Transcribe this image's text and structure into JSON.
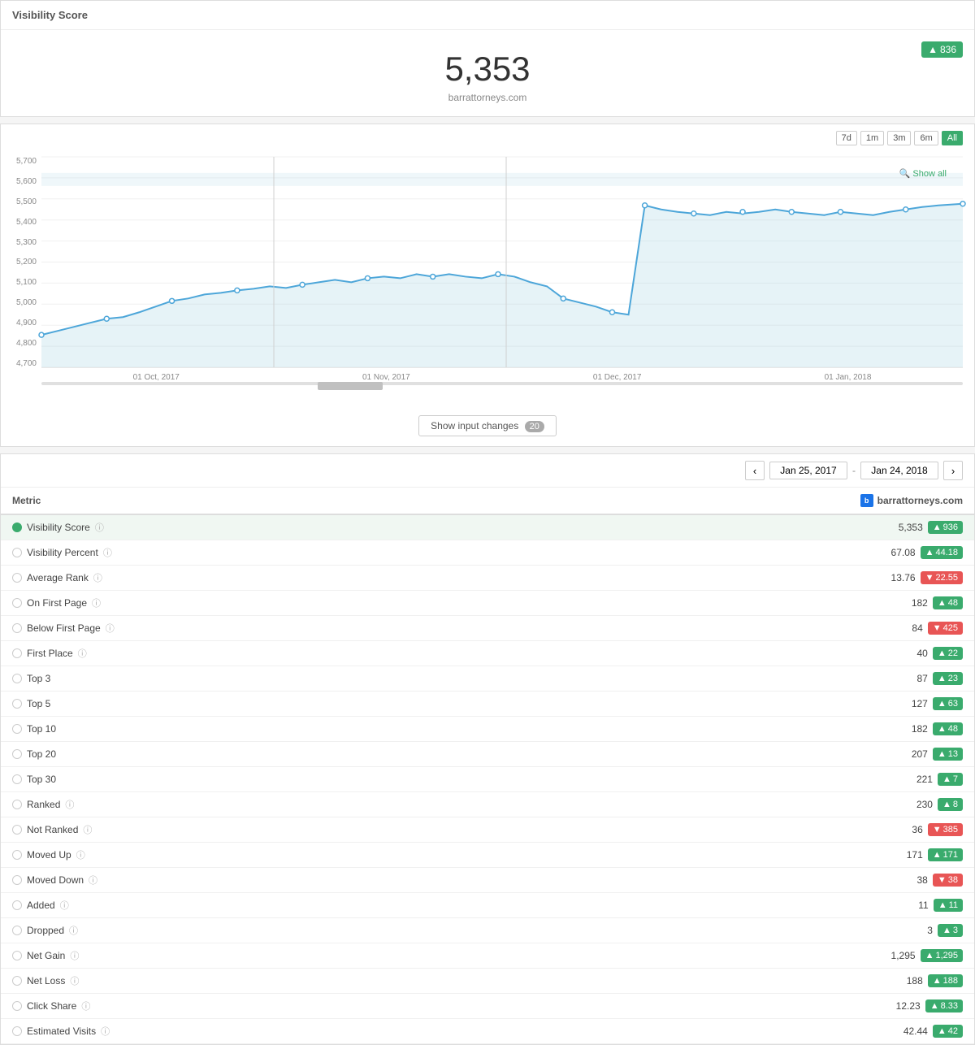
{
  "page": {
    "visibility_score_header": "Visibility Score",
    "big_number": "5,353",
    "domain": "barrattorneys.com",
    "top_badge": "836",
    "time_buttons": [
      "7d",
      "1m",
      "3m",
      "6m",
      "All"
    ],
    "active_time": "All",
    "show_all_label": "Show all",
    "show_input_label": "Show input changes",
    "show_input_count": "20",
    "y_labels": [
      "5,700",
      "5,600",
      "5,500",
      "5,400",
      "5,300",
      "5,200",
      "5,100",
      "5,000",
      "4,900",
      "4,800",
      "4,700"
    ],
    "x_labels": [
      "01 Oct, 2017",
      "01 Nov, 2017",
      "01 Dec, 2017",
      "01 Jan, 2018"
    ],
    "date_from": "Jan 25, 2017",
    "date_to": "Jan 24, 2018",
    "domain_icon_label": "b",
    "domain_col_header": "barrattorneys.com",
    "col_metric": "Metric",
    "metrics": [
      {
        "name": "Visibility Score",
        "info": true,
        "value": "5,353",
        "badge": "936",
        "direction": "up",
        "selected": true
      },
      {
        "name": "Visibility Percent",
        "info": true,
        "value": "67.08",
        "badge": "44.18",
        "direction": "up",
        "selected": false
      },
      {
        "name": "Average Rank",
        "info": true,
        "value": "13.76",
        "badge": "22.55",
        "direction": "down",
        "selected": false
      },
      {
        "name": "On First Page",
        "info": true,
        "value": "182",
        "badge": "48",
        "direction": "up",
        "selected": false
      },
      {
        "name": "Below First Page",
        "info": true,
        "value": "84",
        "badge": "425",
        "direction": "down",
        "selected": false
      },
      {
        "name": "First Place",
        "info": true,
        "value": "40",
        "badge": "22",
        "direction": "up",
        "selected": false
      },
      {
        "name": "Top 3",
        "info": false,
        "value": "87",
        "badge": "23",
        "direction": "up",
        "selected": false
      },
      {
        "name": "Top 5",
        "info": false,
        "value": "127",
        "badge": "63",
        "direction": "up",
        "selected": false
      },
      {
        "name": "Top 10",
        "info": false,
        "value": "182",
        "badge": "48",
        "direction": "up",
        "selected": false
      },
      {
        "name": "Top 20",
        "info": false,
        "value": "207",
        "badge": "13",
        "direction": "up",
        "selected": false
      },
      {
        "name": "Top 30",
        "info": false,
        "value": "221",
        "badge": "7",
        "direction": "up",
        "selected": false
      },
      {
        "name": "Ranked",
        "info": true,
        "value": "230",
        "badge": "8",
        "direction": "up",
        "selected": false
      },
      {
        "name": "Not Ranked",
        "info": true,
        "value": "36",
        "badge": "385",
        "direction": "down",
        "selected": false
      },
      {
        "name": "Moved Up",
        "info": true,
        "value": "171",
        "badge": "171",
        "direction": "up",
        "selected": false
      },
      {
        "name": "Moved Down",
        "info": true,
        "value": "38",
        "badge": "38",
        "direction": "down",
        "selected": false
      },
      {
        "name": "Added",
        "info": true,
        "value": "11",
        "badge": "11",
        "direction": "up",
        "selected": false
      },
      {
        "name": "Dropped",
        "info": true,
        "value": "3",
        "badge": "3",
        "direction": "up",
        "selected": false
      },
      {
        "name": "Net Gain",
        "info": true,
        "value": "1,295",
        "badge": "1,295",
        "direction": "up",
        "selected": false
      },
      {
        "name": "Net Loss",
        "info": true,
        "value": "188",
        "badge": "188",
        "direction": "up",
        "selected": false
      },
      {
        "name": "Click Share",
        "info": true,
        "value": "12.23",
        "badge": "8.33",
        "direction": "up",
        "selected": false
      },
      {
        "name": "Estimated Visits",
        "info": true,
        "value": "42.44",
        "badge": "42",
        "direction": "up",
        "selected": false
      }
    ]
  }
}
